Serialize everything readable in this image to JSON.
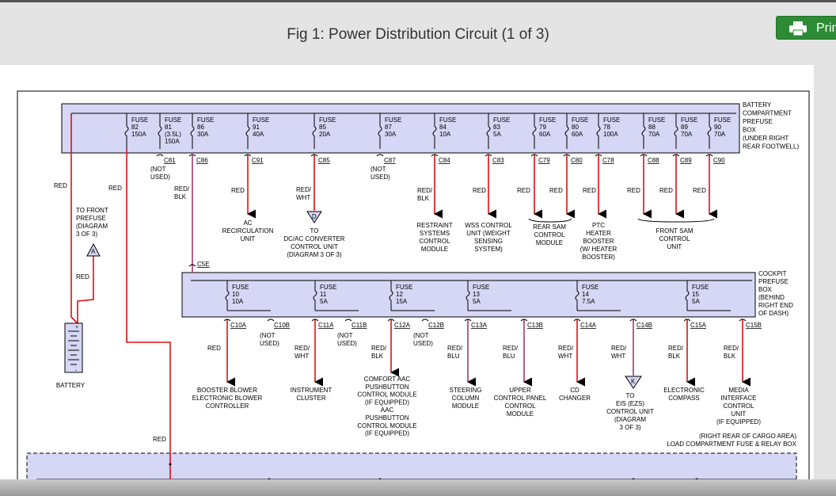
{
  "title": "Fig 1: Power Distribution Circuit (1 of 3)",
  "print_label": "Print",
  "prefuse_box": {
    "label": [
      "BATTERY",
      "COMPARTMENT",
      "PREFUSE",
      "BOX",
      "(UNDER RIGHT",
      "REAR FOOTWELL)"
    ],
    "fuses": [
      {
        "num": "82",
        "amp": "150A"
      },
      {
        "num": "81",
        "amp": "150A",
        "note": "(3.5L)"
      },
      {
        "num": "86",
        "amp": "30A"
      },
      {
        "num": "91",
        "amp": "40A"
      },
      {
        "num": "85",
        "amp": "20A"
      },
      {
        "num": "87",
        "amp": "30A"
      },
      {
        "num": "84",
        "amp": "10A"
      },
      {
        "num": "83",
        "amp": "5A"
      },
      {
        "num": "79",
        "amp": "60A"
      },
      {
        "num": "80",
        "amp": "60A"
      },
      {
        "num": "78",
        "amp": "100A"
      },
      {
        "num": "88",
        "amp": "70A"
      },
      {
        "num": "89",
        "amp": "70A"
      },
      {
        "num": "90",
        "amp": "70A"
      }
    ],
    "connectors": [
      "C81",
      "C86",
      "C91",
      "C85",
      "C87",
      "C84",
      "C83",
      "C79",
      "C80",
      "C78",
      "C88",
      "C89",
      "C90"
    ]
  },
  "cockpit_box": {
    "label": [
      "COCKPIT",
      "PREFUSE",
      "BOX",
      "(BEHIND",
      "RIGHT END",
      "OF DASH)"
    ],
    "fuses": [
      {
        "num": "10",
        "amp": "10A"
      },
      {
        "num": "11",
        "amp": "5A"
      },
      {
        "num": "12",
        "amp": "15A"
      },
      {
        "num": "13",
        "amp": "5A"
      },
      {
        "num": "14",
        "amp": "7.5A"
      },
      {
        "num": "15",
        "amp": "5A"
      }
    ],
    "connectors": [
      "C10A",
      "C10B",
      "C11A",
      "C11B",
      "C12A",
      "C12B",
      "C13A",
      "C13B",
      "C14A",
      "C14B",
      "C15A",
      "C15B"
    ]
  },
  "fuse_word": "FUSE",
  "not_used": [
    "(NOT",
    "USED)"
  ],
  "c5e": "C5E",
  "wire_labels": {
    "red": "RED",
    "red_blk": [
      "RED/",
      "BLK"
    ],
    "red_wht": [
      "RED/",
      "WHT"
    ],
    "red_blu": [
      "RED/",
      "BLU"
    ]
  },
  "top_loads": {
    "ac": [
      "AC",
      "RECIRCULATION",
      "UNIT"
    ],
    "dcac": [
      "TO",
      "DC/AC CONVERTER",
      "CONTROL UNIT",
      "(DIAGRAM 3 OF 3)"
    ],
    "restraint": [
      "RESTRAINT",
      "SYSTEMS",
      "CONTROL",
      "MODULE"
    ],
    "wss": [
      "WSS CONTROL",
      "UNIT (WEIGHT",
      "SENSING",
      "SYSTEM)"
    ],
    "rear_sam": [
      "REAR SAM",
      "CONTROL",
      "MODULE"
    ],
    "ptc": [
      "PTC",
      "HEATER",
      "BOOSTER",
      "(W/ HEATER",
      "BOOSTER)"
    ],
    "front_sam": [
      "FRONT SAM",
      "CONTROL",
      "UNIT"
    ],
    "front_prefuse": [
      "TO FRONT",
      "PREFUSE",
      "(DIAGRAM",
      "3 OF 3)"
    ]
  },
  "bottom_loads": {
    "booster": [
      "BOOSTER BLOWER",
      "ELECTRONIC BLOWER",
      "CONTROLLER"
    ],
    "instrument": [
      "INSTRUMENT",
      "CLUSTER"
    ],
    "comfort": [
      "COMFORT AAC",
      "PUSHBUTTON",
      "CONTROL MODULE",
      "(IF EQUIPPED)",
      "AAC",
      "PUSHBUTTON",
      "CONTROL MODULE",
      "(IF EQUIPPED)"
    ],
    "steering": [
      "STEERING",
      "COLUMN",
      "MODULE"
    ],
    "upper": [
      "UPPER",
      "CONTROL PANEL",
      "CONTROL",
      "MODULE"
    ],
    "cd": [
      "CD",
      "CHANGER"
    ],
    "eis": [
      "TO",
      "EIS (EZS)",
      "CONTROL UNIT",
      "(DIAGRAM",
      "3 OF 3)"
    ],
    "compass": [
      "ELECTRONIC",
      "COMPASS"
    ],
    "media": [
      "MEDIA",
      "INTERFACE",
      "CONTROL",
      "UNIT",
      "(IF EQUIPPED)"
    ]
  },
  "battery": "BATTERY",
  "ref_a": "A",
  "ref_d": "D",
  "ref_k": "K",
  "load_box_label": [
    "(RIGHT REAR OF CARGO AREA)",
    "LOAD COMPARTMENT FUSE & RELAY BOX"
  ]
}
